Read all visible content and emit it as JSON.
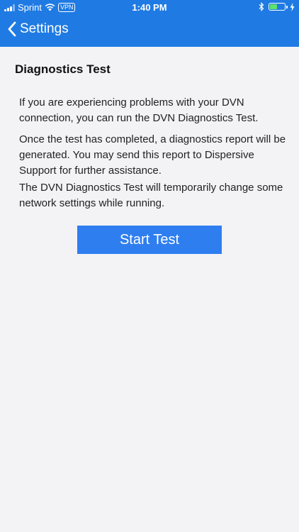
{
  "status_bar": {
    "carrier": "Sprint",
    "vpn_label": "VPN",
    "time": "1:40 PM",
    "battery_fraction": 0.55,
    "icons": [
      "signal-icon",
      "wifi-icon",
      "vpn-icon",
      "bluetooth-icon",
      "battery-icon",
      "charging-icon"
    ]
  },
  "nav": {
    "back_label": "Settings",
    "back_icon": "chevron-left-icon"
  },
  "page": {
    "title": "Diagnostics Test",
    "paragraphs": [
      "If you are experiencing problems with your DVN connection, you can run the DVN Diagnostics Test.",
      "Once the test has completed, a diagnostics report will be generated. You may send this report to Dispersive Support for further assistance.",
      "The DVN Diagnostics Test will temporarily change some network settings while running."
    ],
    "start_button_label": "Start Test"
  },
  "colors": {
    "nav_bar": "#1f7be3",
    "button": "#2e7ef0",
    "background": "#f3f3f6",
    "battery_fill": "#5ee26b"
  }
}
